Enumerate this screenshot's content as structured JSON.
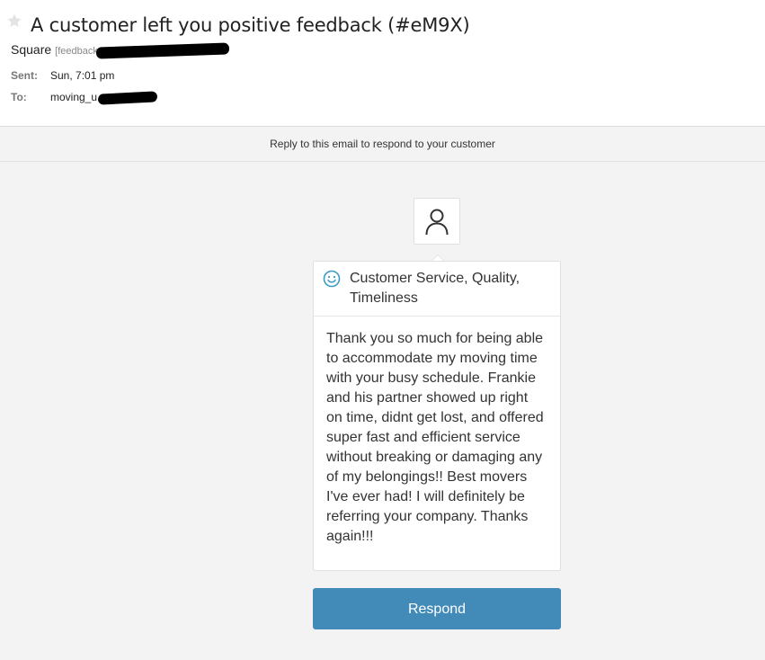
{
  "email": {
    "subject": "A customer left you positive feedback (#eM9X)",
    "from_name": "Square",
    "from_address": "[feedback",
    "sent_label": "Sent:",
    "sent_value": "Sun, 7:01 pm",
    "to_label": "To:",
    "to_value": "moving_u"
  },
  "banner": {
    "text": "Reply to this email to respond to your customer"
  },
  "feedback": {
    "categories": "Customer Service, Quality, Timeliness",
    "comment": "Thank you so much for being able to accommodate my moving time with your busy schedule. Frankie and his partner showed up right on time, didnt get lost, and offered super fast and efficient service without breaking or damaging any of my belongings!! Best movers I've ever had! I will definitely be referring your company. Thanks again!!!",
    "sentiment_icon": "smiley-icon",
    "accent_color": "#3b9bc8"
  },
  "actions": {
    "respond_label": "Respond",
    "respond_color": "#428bb8"
  }
}
